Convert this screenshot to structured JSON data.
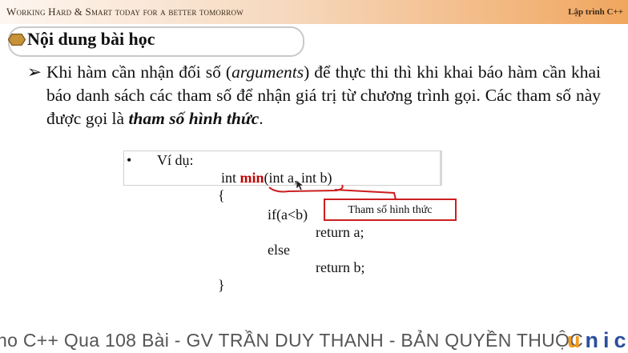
{
  "header": {
    "tagline": "Working Hard & Smart today for a better tomorrow",
    "course": "Lập trình C++"
  },
  "slide": {
    "title": "Nội dung bài học",
    "bullet_marker": "➢",
    "paragraph": {
      "part1": "Khi hàm cần nhận đối số (",
      "italic": "arguments",
      "part2": ") để thực thi thì khi khai báo hàm cần khai báo danh sách các tham số để nhận giá trị từ chương trình gọi. Các tham số này được gọi là ",
      "bold_italic": "tham số hình thức",
      "part3": "."
    },
    "example": {
      "bullet": "•",
      "label": "Ví dụ:",
      "line1_prefix": "int ",
      "line1_fn": "min",
      "line1_suffix": "(int a, int b)",
      "open_brace": "{",
      "line_if": "if(a<b)",
      "line_ret_a": "return a;",
      "line_else": "else",
      "line_ret_b": "return b;",
      "close_brace": "}"
    },
    "callout": "Tham số hình thức"
  },
  "footer": {
    "marquee": "ho C++ Qua 108 Bài - GV TRẦN DUY THANH - BẢN QUYỀN THUỘC",
    "brand_u": "u",
    "brand_rest": "nic"
  },
  "colors": {
    "header_gradient_end": "#f0a65e",
    "function_name": "#c00000",
    "callout_border": "#cc1f1f",
    "brand_blue": "#2b4f9e",
    "brand_orange": "#f39a1e"
  }
}
